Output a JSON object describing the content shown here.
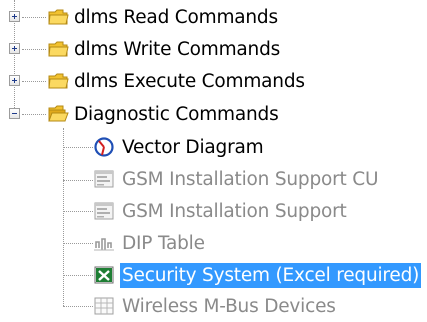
{
  "tree": {
    "groups": [
      {
        "label": "dlms Read Commands",
        "expanded": false,
        "icon": "folder-icon"
      },
      {
        "label": "dlms Write Commands",
        "expanded": false,
        "icon": "folder-icon"
      },
      {
        "label": "dlms Execute Commands",
        "expanded": false,
        "icon": "folder-icon"
      },
      {
        "label": "Diagnostic Commands",
        "expanded": true,
        "icon": "open-folder-icon"
      }
    ],
    "diagnostic_items": [
      {
        "label": "Vector Diagram",
        "enabled": true,
        "selected": false,
        "icon": "vector-diagram-icon"
      },
      {
        "label": "GSM Installation Support CU",
        "enabled": false,
        "selected": false,
        "icon": "form-icon"
      },
      {
        "label": "GSM Installation Support",
        "enabled": false,
        "selected": false,
        "icon": "form-icon"
      },
      {
        "label": "DIP Table",
        "enabled": false,
        "selected": false,
        "icon": "dip-table-icon"
      },
      {
        "label": "Security System (Excel required)",
        "enabled": true,
        "selected": true,
        "icon": "excel-icon"
      },
      {
        "label": "Wireless M-Bus Devices",
        "enabled": false,
        "selected": false,
        "icon": "grid-icon"
      }
    ],
    "colors": {
      "selection": "#3399ff",
      "disabled_text": "#8a8a8a",
      "folder": "#f2c230"
    }
  }
}
